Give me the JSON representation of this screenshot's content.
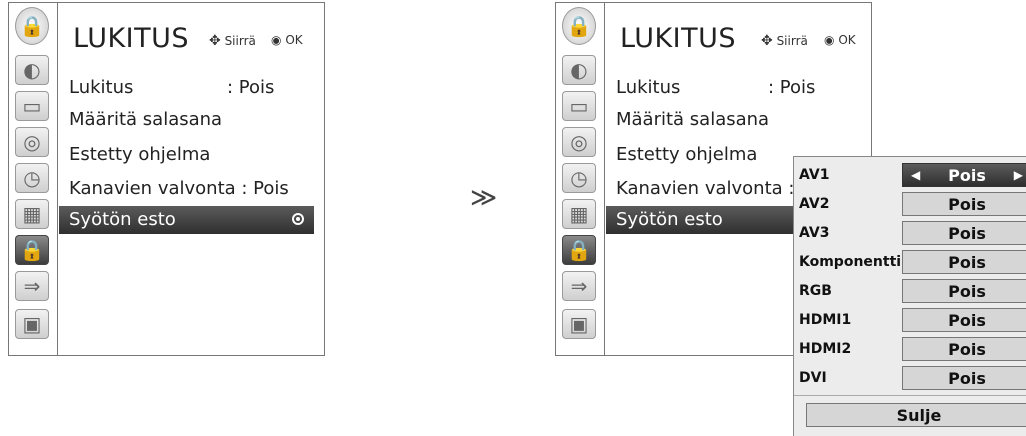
{
  "left_menu": {
    "title": "LUKITUS",
    "hint_move": "Siirrä",
    "hint_ok": "OK",
    "items": [
      {
        "label": "Lukitus",
        "value": ": Pois"
      },
      {
        "label": "Määritä salasana"
      },
      {
        "label": "Estetty ohjelma"
      },
      {
        "label": "Kanavien valvonta : Pois"
      },
      {
        "label": "Syötön esto"
      }
    ]
  },
  "right_menu": {
    "title": "LUKITUS",
    "hint_move": "Siirrä",
    "hint_ok": "OK",
    "items": [
      {
        "label": "Lukitus",
        "value": ": Pois"
      },
      {
        "label": "Määritä salasana"
      },
      {
        "label": "Estetty ohjelma"
      },
      {
        "label": "Kanavien valvonta : Pc"
      },
      {
        "label": "Syötön esto"
      }
    ]
  },
  "sidebar_icons": [
    "lock-icon",
    "globe-icon",
    "monitor-icon",
    "speaker-icon",
    "clock-icon",
    "calendar-icon",
    "lock-icon",
    "plug-icon",
    "photo-icon"
  ],
  "arrow_glyph": "≫",
  "popup": {
    "rows": [
      {
        "label": "AV1",
        "value": "Pois"
      },
      {
        "label": "AV2",
        "value": "Pois"
      },
      {
        "label": "AV3",
        "value": "Pois"
      },
      {
        "label": "Komponentti",
        "value": "Pois"
      },
      {
        "label": "RGB",
        "value": "Pois"
      },
      {
        "label": "HDMI1",
        "value": "Pois"
      },
      {
        "label": "HDMI2",
        "value": "Pois"
      },
      {
        "label": "DVI",
        "value": "Pois"
      }
    ],
    "close_label": "Sulje"
  },
  "colors": {
    "selection": "#3d3d3d",
    "popup_bg": "#ececec",
    "box_bg": "#d6d6d6"
  }
}
